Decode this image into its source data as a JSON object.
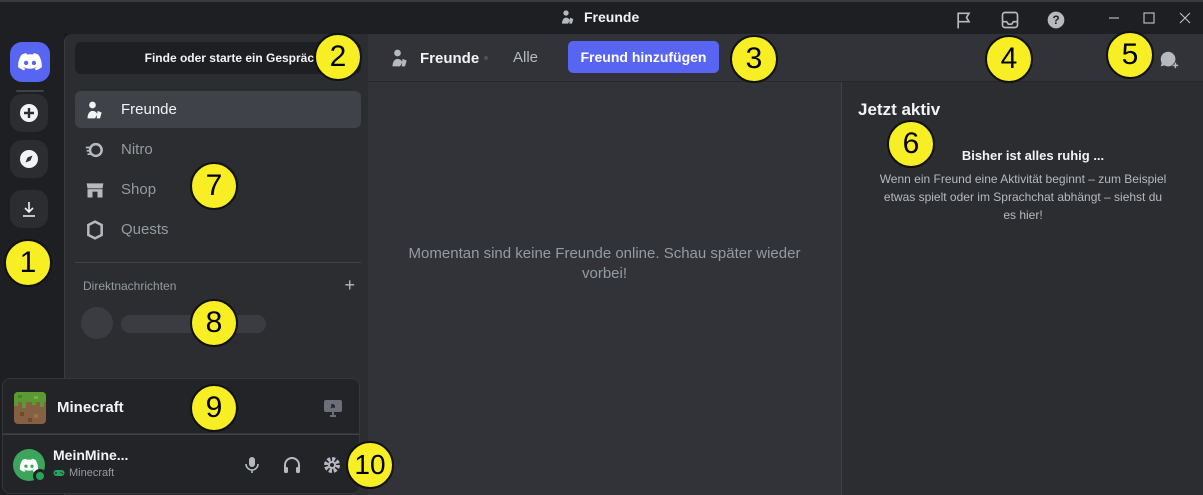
{
  "window": {
    "title": "Freunde"
  },
  "sidebar": {
    "search_label": "Finde oder starte ein Gespräch",
    "nav": [
      {
        "label": "Freunde",
        "icon": "friends-icon"
      },
      {
        "label": "Nitro",
        "icon": "nitro-icon"
      },
      {
        "label": "Shop",
        "icon": "shop-icon"
      },
      {
        "label": "Quests",
        "icon": "quests-icon"
      }
    ],
    "dm_header": "Direktnachrichten",
    "dm_plus": "+"
  },
  "header": {
    "title": "Freunde",
    "tab_all": "Alle",
    "add_friend": "Freund hinzufügen"
  },
  "main": {
    "empty_message": "Momentan sind keine Freunde online. Schau später wieder vorbei!"
  },
  "active_now": {
    "title": "Jetzt aktiv",
    "quiet_title": "Bisher ist alles ruhig ...",
    "quiet_desc": "Wenn ein Freund eine Aktivität beginnt – zum Beispiel etwas spielt oder im Sprachchat abhängt – siehst du es hier!"
  },
  "game_panel": {
    "name": "Minecraft"
  },
  "user_panel": {
    "name": "MeinMine...",
    "activity": "Minecraft"
  },
  "badges": [
    "1",
    "2",
    "3",
    "4",
    "5",
    "6",
    "7",
    "8",
    "9",
    "10"
  ],
  "colors": {
    "accent": "#5865f2",
    "online": "#23a55a",
    "badge": "#f7ee23"
  }
}
